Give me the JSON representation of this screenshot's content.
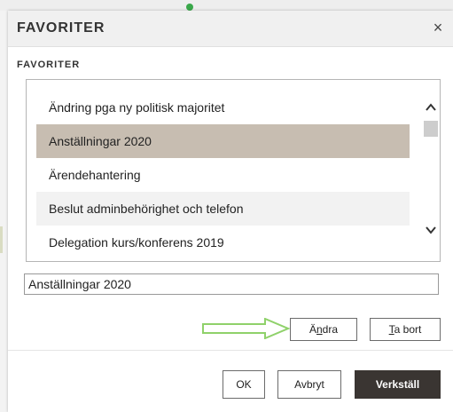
{
  "dialog": {
    "title": "FAVORITER",
    "close_glyph": "×",
    "section_label": "FAVORITER"
  },
  "list": {
    "items": [
      {
        "label": "Ändring pga ny politisk majoritet",
        "selected": false
      },
      {
        "label": "Anställningar 2020",
        "selected": true
      },
      {
        "label": "Ärendehantering",
        "selected": false
      },
      {
        "label": "Beslut adminbehörighet och telefon",
        "selected": false
      },
      {
        "label": "Delegation kurs/konferens 2019",
        "selected": false
      }
    ],
    "scroll_up_glyph": "^",
    "scroll_down_glyph": "v"
  },
  "name_input": {
    "value": "Anställningar 2020"
  },
  "actions": {
    "change_pre": "Ä",
    "change_ul": "n",
    "change_post": "dra",
    "remove_ul": "T",
    "remove_post": "a bort"
  },
  "footer": {
    "ok_label": "OK",
    "cancel_label": "Avbryt",
    "apply_label": "Verkställ"
  },
  "colors": {
    "selected_row": "#c7bdb1",
    "apply_button": "#3a3532",
    "arrow_outline": "#8fd16a"
  },
  "icons": {
    "close": "close-icon",
    "scroll_up": "chevron-up-icon",
    "scroll_down": "chevron-down-icon",
    "arrow": "arrow-right-icon"
  }
}
